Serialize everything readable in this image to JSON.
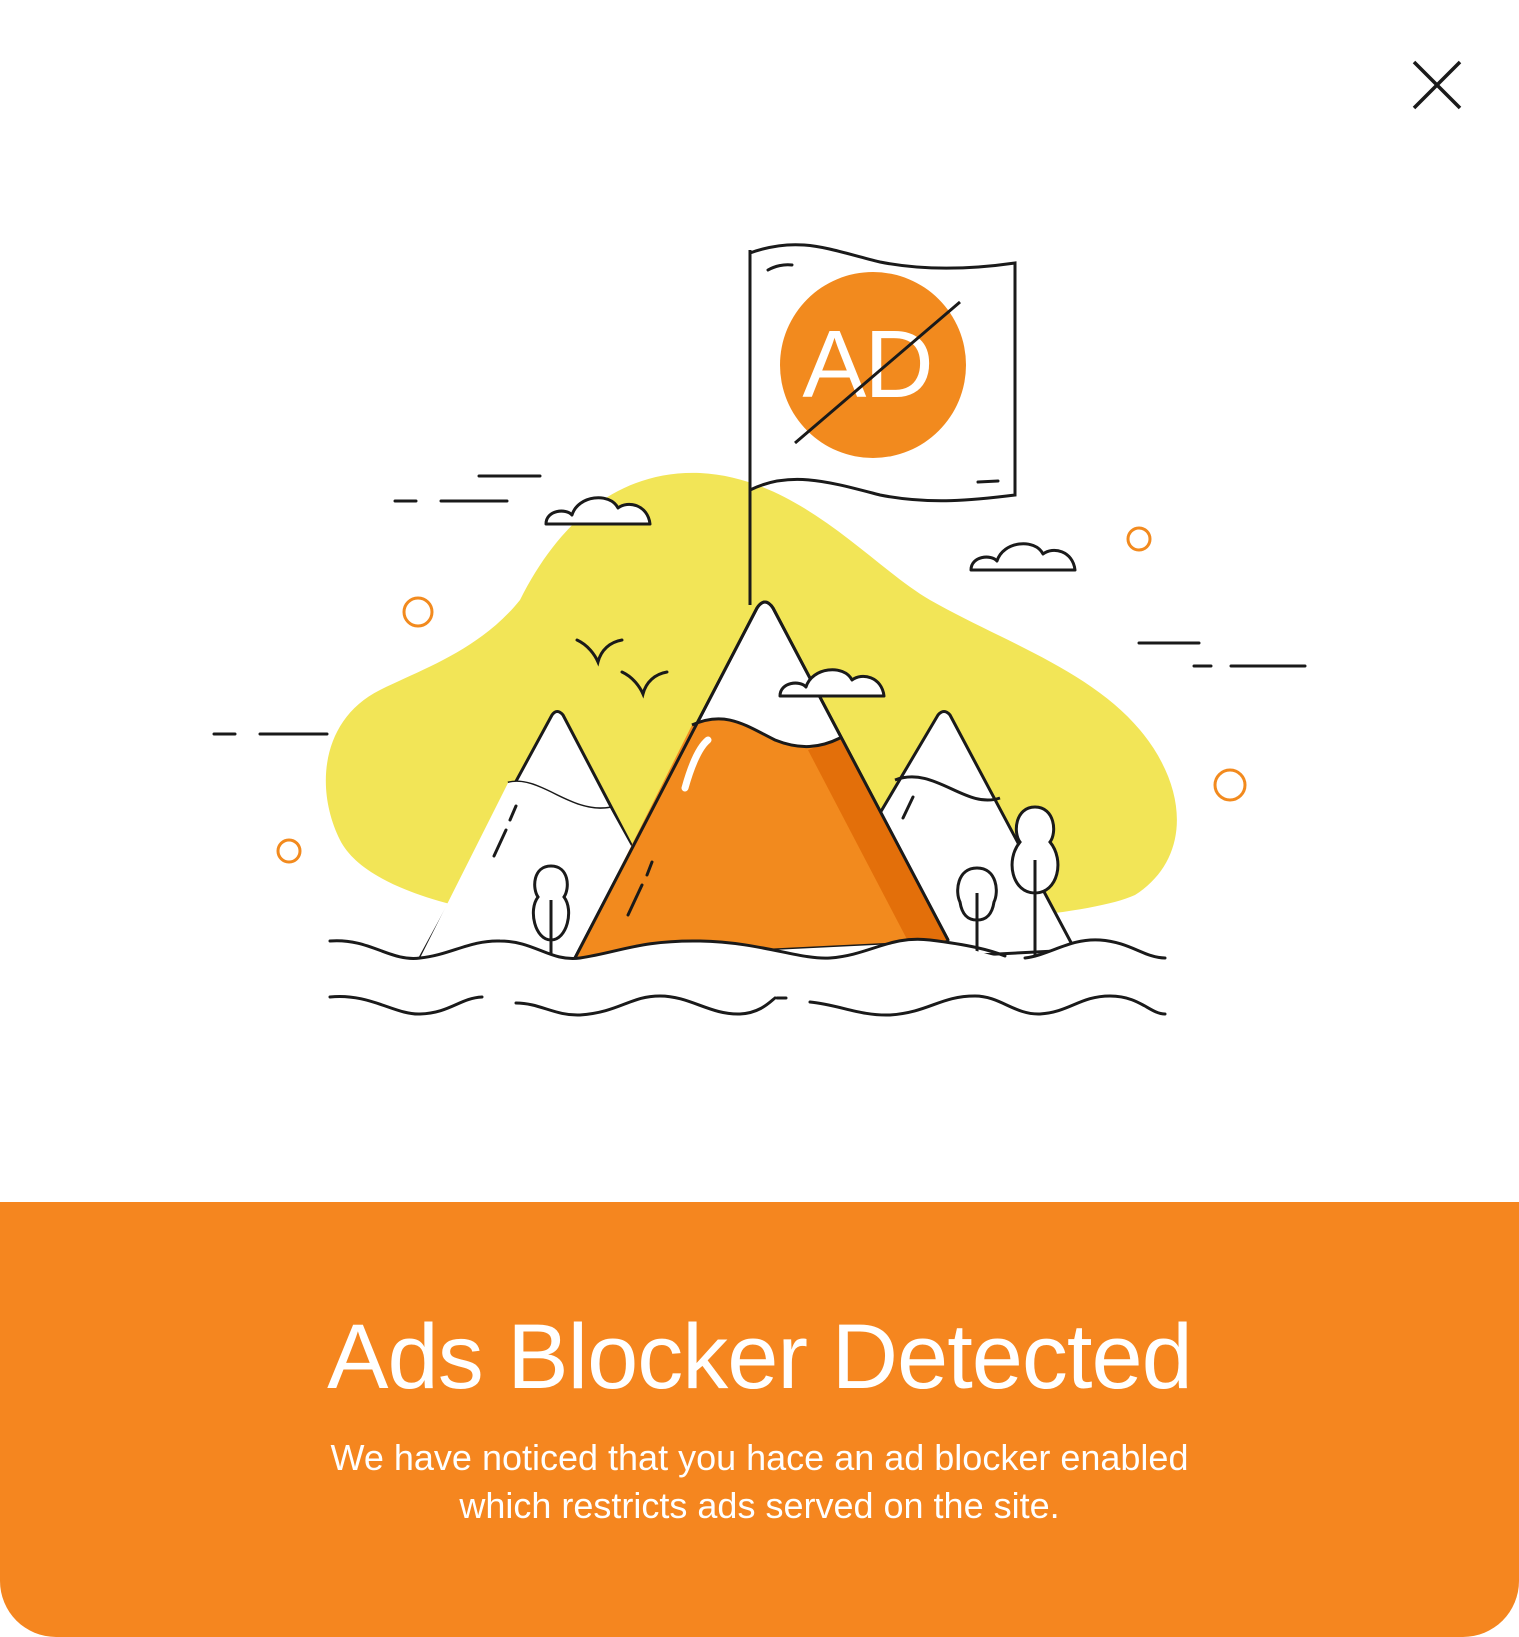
{
  "dialog": {
    "close_icon": "close-icon",
    "illustration": {
      "flag_badge_text": "AD",
      "icon": "no-ads-mountain-flag-illustration"
    },
    "title": "Ads Blocker Detected",
    "message_line1": "We have noticed that you hace an ad blocker enabled",
    "message_line2": "which restricts ads served on the site."
  },
  "colors": {
    "accent": "#f5861f",
    "blob": "#f2e557",
    "mountain_orange": "#f28a1e",
    "mountain_shade": "#e36f0a",
    "stroke": "#1a1a1a",
    "background": "#ffffff"
  }
}
